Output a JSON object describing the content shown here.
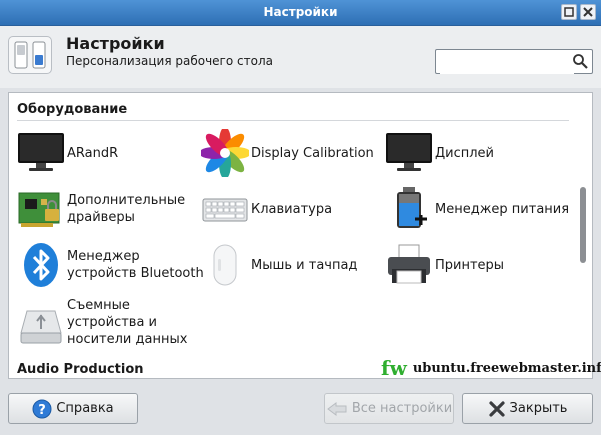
{
  "window": {
    "title": "Настройки"
  },
  "header": {
    "title": "Настройки",
    "subtitle": "Персонализация рабочего стола",
    "search": {
      "value": "",
      "placeholder": ""
    }
  },
  "sections": [
    {
      "title": "Оборудование",
      "items": [
        {
          "label": "ARandR",
          "icon": "monitor-icon"
        },
        {
          "label": "Display Calibration",
          "icon": "color-flower-icon"
        },
        {
          "label": "Дисплей",
          "icon": "monitor-icon"
        },
        {
          "label": "Дополнительные\nдрайверы",
          "icon": "circuit-board-icon"
        },
        {
          "label": "Клавиатура",
          "icon": "keyboard-icon"
        },
        {
          "label": "Менеджер питания",
          "icon": "battery-icon"
        },
        {
          "label": "Менеджер\nустройств Bluetooth",
          "icon": "bluetooth-icon"
        },
        {
          "label": "Мышь и тачпад",
          "icon": "mouse-icon"
        },
        {
          "label": "Принтеры",
          "icon": "printer-icon"
        },
        {
          "label": "Съемные\nустройства и\nносители данных",
          "icon": "removable-drive-icon"
        }
      ]
    },
    {
      "title": "Audio Production",
      "items": []
    }
  ],
  "watermark": {
    "logo": "fw",
    "url": "ubuntu.freewebmaster.info"
  },
  "buttons": {
    "help": "Справка",
    "all_settings": "Все настройки",
    "close": "Закрыть"
  }
}
